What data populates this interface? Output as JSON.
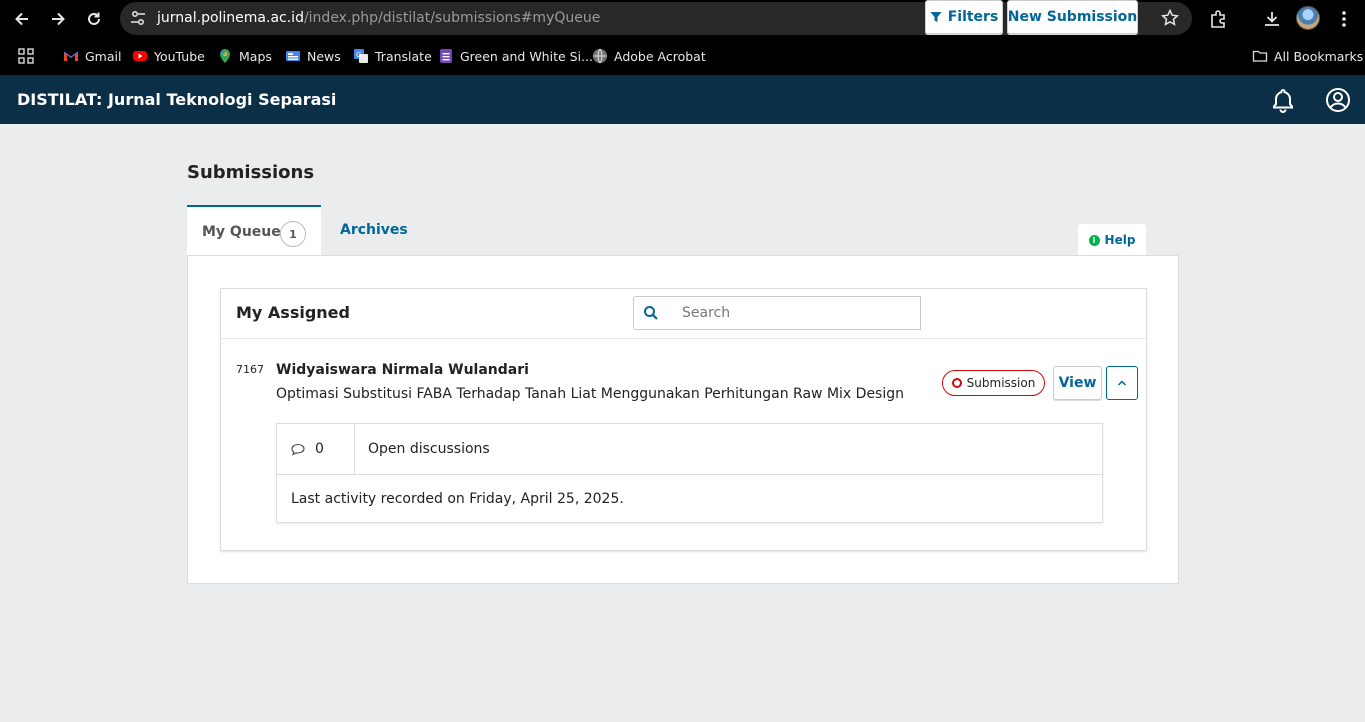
{
  "browser": {
    "url_host": "jurnal.polinema.ac.id",
    "url_path": "/index.php/distilat/submissions#myQueue",
    "icons": [
      "back-icon",
      "forward-icon",
      "reload-icon",
      "site-settings-icon",
      "bookmark-star-icon",
      "extensions-icon",
      "downloads-icon",
      "profile-avatar",
      "more-menu-icon"
    ]
  },
  "bookmarks": {
    "items": [
      {
        "label": "Gmail"
      },
      {
        "label": "YouTube"
      },
      {
        "label": "Maps"
      },
      {
        "label": "News"
      },
      {
        "label": "Translate"
      },
      {
        "label": "Green and White Si..."
      },
      {
        "label": "Adobe Acrobat"
      }
    ],
    "all_bookmarks": "All Bookmarks"
  },
  "header": {
    "title": "DISTILAT: Jurnal Teknologi Separasi",
    "bg_color": "#0a2f46"
  },
  "page": {
    "title": "Submissions",
    "tabs": [
      {
        "label": "My Queue",
        "count": "1",
        "active": true
      },
      {
        "label": "Archives",
        "active": false
      }
    ],
    "help_label": "Help"
  },
  "list": {
    "title": "My Assigned",
    "search_placeholder": "Search",
    "filters_label": "Filters",
    "new_submission_label": "New Submission"
  },
  "submission": {
    "id": "7167",
    "author": "Widyaiswara Nirmala Wulandari",
    "title": "Optimasi Substitusi FABA Terhadap Tanah Liat Menggunakan Perhitungan Raw Mix Design",
    "stage": "Submission",
    "stage_color": "#d00a0a",
    "view_label": "View",
    "discussions_count": "0",
    "discussions_label": "Open discussions",
    "last_activity": "Last activity recorded on Friday, April 25, 2025."
  },
  "colors": {
    "link": "#006798",
    "page_bg": "#eaeced"
  }
}
